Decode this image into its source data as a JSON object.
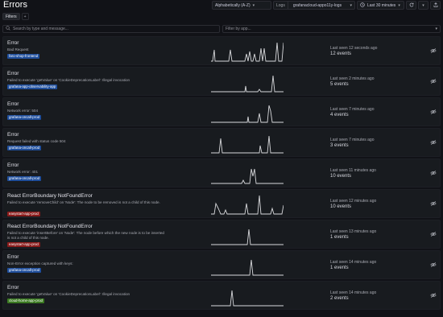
{
  "page": {
    "title": "Errors"
  },
  "toolbar": {
    "sort_label": "Alphabetically (A-Z)",
    "logs_label": "Logs",
    "logs_value": "grafanacloud-appo11y-logs",
    "time_range": "Last 30 minutes",
    "icons": [
      "chevron-down-icon",
      "clock-icon",
      "refresh-icon",
      "share-icon"
    ]
  },
  "tabs": [
    {
      "label": "Filters"
    },
    {
      "label": "+"
    }
  ],
  "search": {
    "placeholder": "Search by type and message...",
    "app_filter_placeholder": "Filter by app..."
  },
  "badge_colors": {
    "blue": "#1f4e9c",
    "red": "#8a1b1b",
    "green": "#3b7a21"
  },
  "errors": [
    {
      "title": "Error",
      "message": "Bad Request",
      "app": "faro-shop-frontend",
      "badge": "blue",
      "last_seen": "Last seen 12 seconds ago",
      "events": "12 events"
    },
    {
      "title": "Error",
      "message": "Failed to execute 'getValue' on 'CookieDeprecationLabel': Illegal invocation",
      "app": "grafana-app-observability-app",
      "badge": "blue",
      "last_seen": "Last seen 2 minutes ago",
      "events": "5 events"
    },
    {
      "title": "Error",
      "message": "Network error: 504",
      "app": "grafana-oncall-prod",
      "badge": "blue",
      "last_seen": "Last seen 7 minutes ago",
      "events": "4 events"
    },
    {
      "title": "Error",
      "message": "Request failed with status code 504",
      "app": "grafana-oncall-prod",
      "badge": "blue",
      "last_seen": "Last seen 7 minutes ago",
      "events": "3 events"
    },
    {
      "title": "Error",
      "message": "Network error: 401",
      "app": "grafana-oncall-prod",
      "badge": "blue",
      "last_seen": "Last seen 11 minutes ago",
      "events": "10 events"
    },
    {
      "title": "React ErrorBoundary NotFoundError",
      "message": "Failed to execute 'removeChild' on 'Node': The node to be removed is not a child of this node.",
      "app": "easystart-app-prod",
      "badge": "red",
      "last_seen": "Last seen 12 minutes ago",
      "events": "10 events"
    },
    {
      "title": "React ErrorBoundary NotFoundError",
      "message": "Failed to execute 'insertBefore' on 'Node': The node before which the new node is to be inserted is not a child of this node.",
      "app": "easystart-app-prod",
      "badge": "red",
      "last_seen": "Last seen 13 minutes ago",
      "events": "1 events"
    },
    {
      "title": "Error",
      "message": "Non-Error exception captured with keys:",
      "app": "grafana-oncall-prod",
      "badge": "blue",
      "last_seen": "Last seen 14 minutes ago",
      "events": "1 events"
    },
    {
      "title": "Error",
      "message": "Failed to execute 'getValue' on 'CookieDeprecationLabel': Illegal invocation",
      "app": "cloud-home-app-prod",
      "badge": "green",
      "last_seen": "Last seen 14 minutes ago",
      "events": "2 events"
    }
  ]
}
